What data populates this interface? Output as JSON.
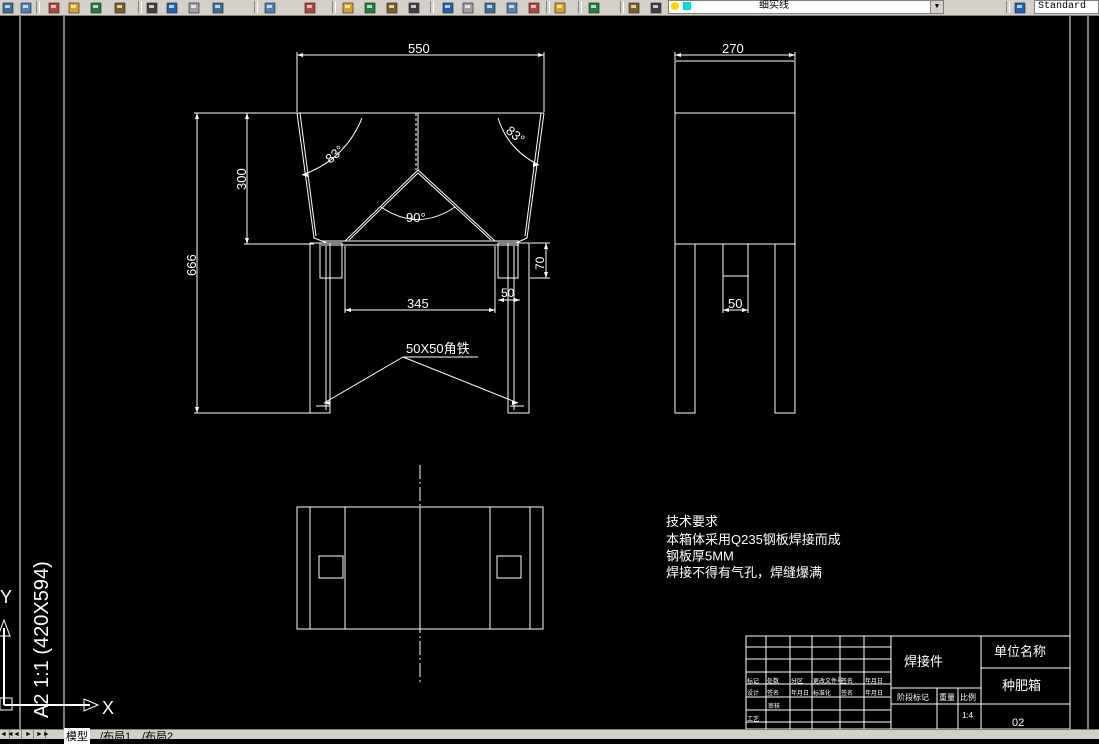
{
  "toolbar": {
    "style_combo": "Standard",
    "linetype_combo": "细实线",
    "icons": [
      "open-icon",
      "save-icon",
      "print-icon",
      "print-preview-icon",
      "publish-icon",
      "3d-publish-icon",
      "cut-icon",
      "copy-icon",
      "paste-icon",
      "match-properties-icon",
      "undo-icon",
      "redo-icon",
      "pan-icon",
      "zoom-realtime-icon",
      "zoom-window-icon",
      "zoom-previous-icon",
      "properties-icon",
      "design-center-icon",
      "tool-palettes-icon",
      "sheet-set-icon",
      "markup-icon",
      "calculator-icon",
      "help-icon",
      "layer-manager-icon",
      "layer-state-icon",
      "text-style-icon"
    ]
  },
  "drawing": {
    "front_view": {
      "dim_top_width": "550",
      "dim_upper_height": "300",
      "dim_total_height": "666",
      "dim_left_angle": "83°",
      "dim_right_angle": "83°",
      "dim_apex_angle": "90°",
      "dim_inner_width": "345",
      "dim_leg_width": "50",
      "dim_leg_top": "70",
      "leader_label": "50X50角铁"
    },
    "side_view": {
      "dim_width": "270",
      "dim_leg_width": "50"
    },
    "tech_requirements": {
      "title": "技术要求",
      "lines": [
        "本箱体采用Q235钢板焊接而成",
        "钢板厚5MM",
        "焊接不得有气孔，焊缝爆满"
      ]
    },
    "title_block": {
      "part_type": "焊接件",
      "unit_label": "单位名称",
      "part_name": "种肥箱",
      "drawing_number": "02",
      "scale": "1:4",
      "row_labels": [
        "标记",
        "处数",
        "分区",
        "更改文件号",
        "签名",
        "年月日"
      ],
      "row_labels_2": [
        "设计",
        "签名",
        "年月日",
        "标准化",
        "签名",
        "年月日"
      ],
      "review": "审核",
      "process": "工艺",
      "stage_label": "阶段标记",
      "weight_label": "重量",
      "scale_label": "比例"
    },
    "sheet_label": "A2 1:1 (420X594)",
    "ucs_x": "X",
    "ucs_y": "Y"
  },
  "tabs": [
    "模型",
    "布局1",
    "布局2"
  ]
}
